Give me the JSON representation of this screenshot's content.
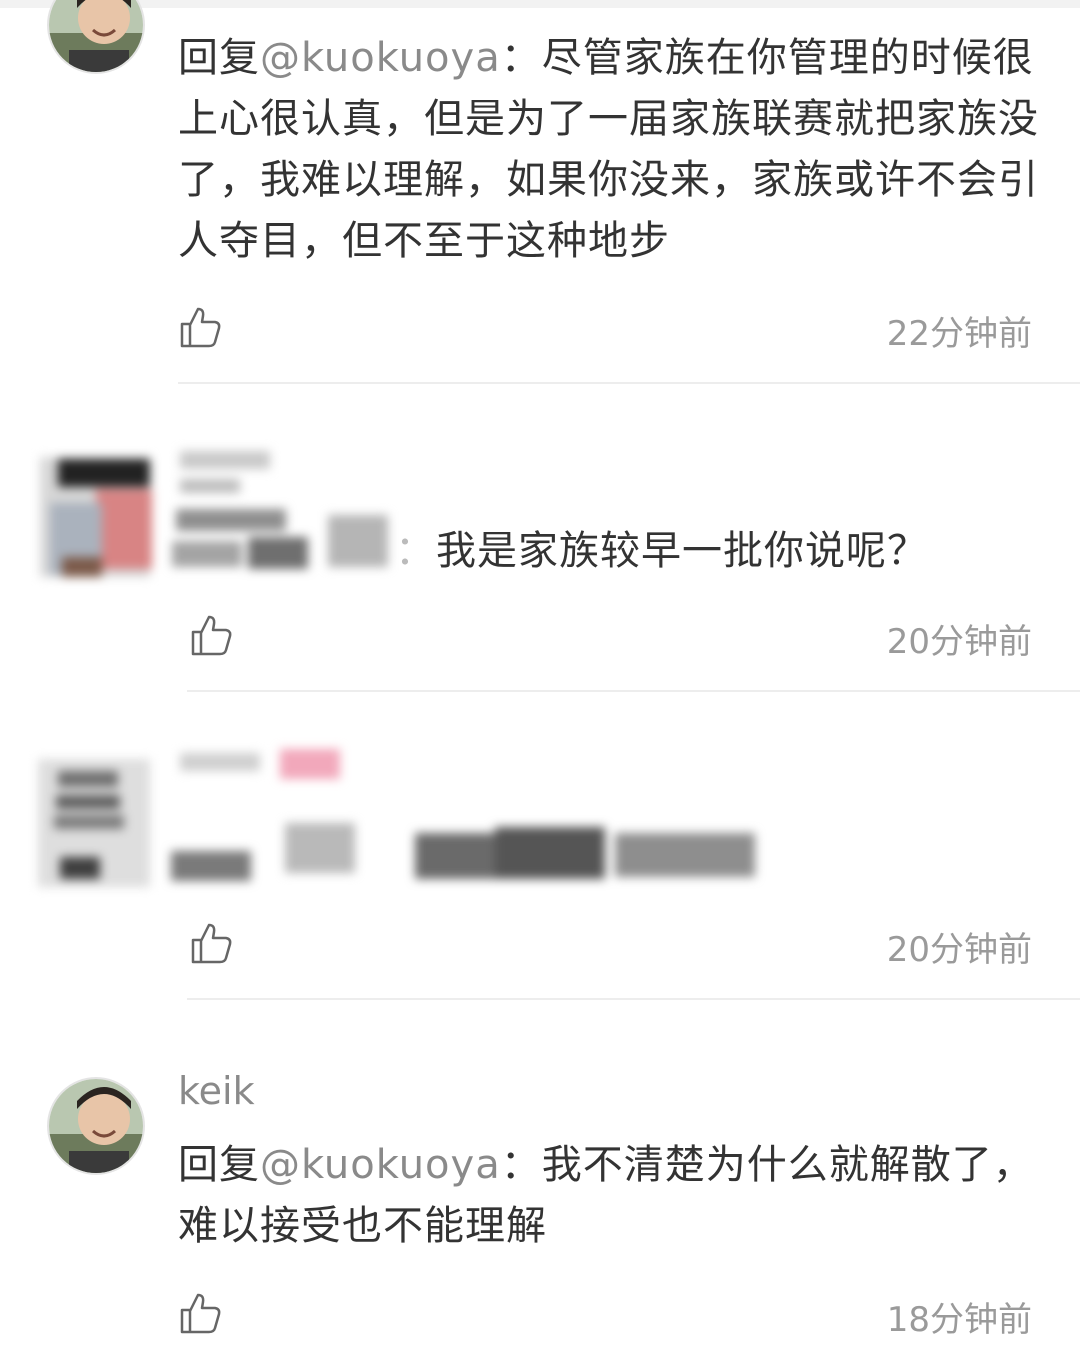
{
  "comments": [
    {
      "username": "",
      "reply_prefix": "回复",
      "mention": "@kuokuoya",
      "separator": "：",
      "text": "尽管家族在你管理的时候很上心很认真，但是为了一届家族联赛就把家族没了，我难以理解，如果你没来，家族或许不会引人夺目，但不至于这种地步",
      "time": "22分钟前",
      "like_icon": "thumbs-up-icon"
    },
    {
      "username": "",
      "separator": "：",
      "text": "我是家族较早一批你说呢？",
      "time": "20分钟前",
      "like_icon": "thumbs-up-icon"
    },
    {
      "username": "",
      "text": "",
      "time": "20分钟前",
      "like_icon": "thumbs-up-icon"
    },
    {
      "username": "keik",
      "reply_prefix": "回复",
      "mention": "@kuokuoya",
      "separator": "：",
      "text": "我不清楚为什么就解散了，难以接受也不能理解",
      "time": "18分钟前",
      "like_icon": "thumbs-up-icon"
    }
  ],
  "colors": {
    "text": "#333333",
    "secondary": "#8a8a8a",
    "timestamp": "#9a9a9a",
    "divider": "#ededed"
  }
}
